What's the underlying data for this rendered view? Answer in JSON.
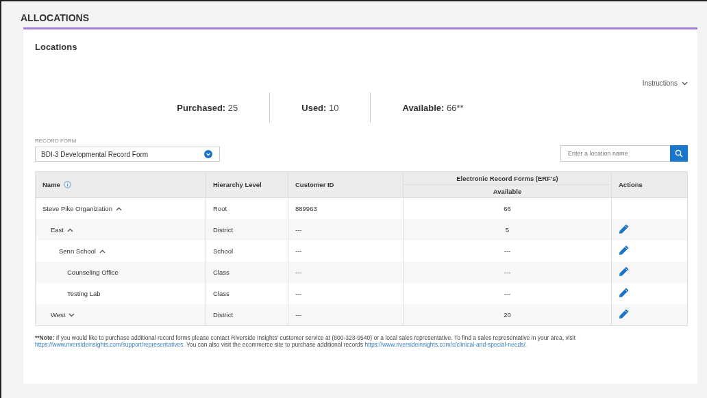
{
  "page_title": "ALLOCATIONS",
  "card": {
    "title": "Locations",
    "instructions": "Instructions",
    "stats": [
      {
        "label": "Purchased:",
        "value": "25"
      },
      {
        "label": "Used:",
        "value": "10"
      },
      {
        "label": "Available:",
        "value": "66**"
      }
    ],
    "record_form": {
      "label": "RECORD FORM",
      "value": "BDI-3 Developmental Record Form"
    },
    "search": {
      "placeholder": "Enter a location name"
    },
    "table": {
      "columns": [
        "Name",
        "Hierarchy Level",
        "Customer ID",
        "Electronic Record Forms (ERF's)",
        "Actions"
      ],
      "subcolumn": "Available",
      "rows": [
        {
          "name": "Steve Pike Organization",
          "level": "Root",
          "customer_id": "889963",
          "available": "66",
          "editable": false,
          "expanded": true,
          "children": [
            {
              "name": "East",
              "level": "District",
              "customer_id": "---",
              "available": "5",
              "editable": true,
              "expanded": true,
              "children": [
                {
                  "name": "Senn School",
                  "level": "School",
                  "customer_id": "---",
                  "available": "---",
                  "editable": true,
                  "expanded": true,
                  "children": [
                    {
                      "name": "Counseling Office",
                      "level": "Class",
                      "customer_id": "---",
                      "available": "---",
                      "editable": true
                    },
                    {
                      "name": "Testing Lab",
                      "level": "Class",
                      "customer_id": "---",
                      "available": "---",
                      "editable": true
                    }
                  ]
                }
              ]
            },
            {
              "name": "West",
              "level": "District",
              "customer_id": "---",
              "available": "20",
              "editable": true,
              "expanded": false
            }
          ]
        }
      ]
    },
    "note": [
      {
        "kind": "strong",
        "text": "**Note:"
      },
      {
        "kind": "text",
        "text": "  If you would like to purchase additional record forms please contact Riverside Insights' customer service at (800-323-9540) or a local sales representative. To find a sales representative in your area, visit "
      },
      {
        "kind": "link",
        "text": "https://www.riversideinsights.com/support/representatives."
      },
      {
        "kind": "text",
        "text": " You can also visit the ecommerce site to purchase additional records "
      },
      {
        "kind": "link",
        "text": "https://www.riversideinsights.com/c/clinical-and-special-needs/."
      }
    ]
  }
}
